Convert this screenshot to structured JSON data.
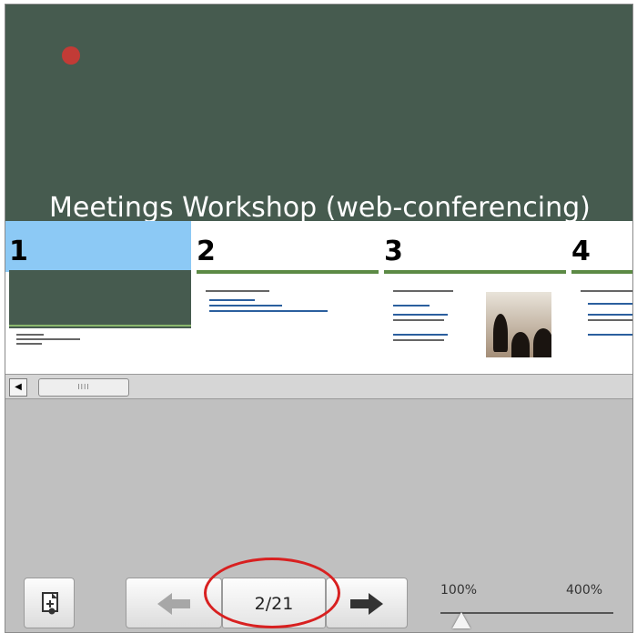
{
  "slide": {
    "title": "Meetings Workshop (web-conferencing)",
    "background_color": "#465b4f",
    "pointer_color": "#c23b36"
  },
  "thumbnails": [
    {
      "number": "1",
      "selected": true
    },
    {
      "number": "2",
      "selected": false
    },
    {
      "number": "3",
      "selected": false
    },
    {
      "number": "4",
      "selected": false
    }
  ],
  "scrollbar": {
    "left_arrow": "◀",
    "thumb_grip": "IIII"
  },
  "toolbar": {
    "add_icon": "add-slide-icon",
    "prev_icon": "arrow-left-icon",
    "next_icon": "arrow-right-icon",
    "page_indicator": "2/21",
    "zoom_min": "100%",
    "zoom_max": "400%",
    "zoom_level_fraction": 0.12
  },
  "colors": {
    "selected": "#8cc9f5",
    "highlight_ring": "#d82020"
  }
}
